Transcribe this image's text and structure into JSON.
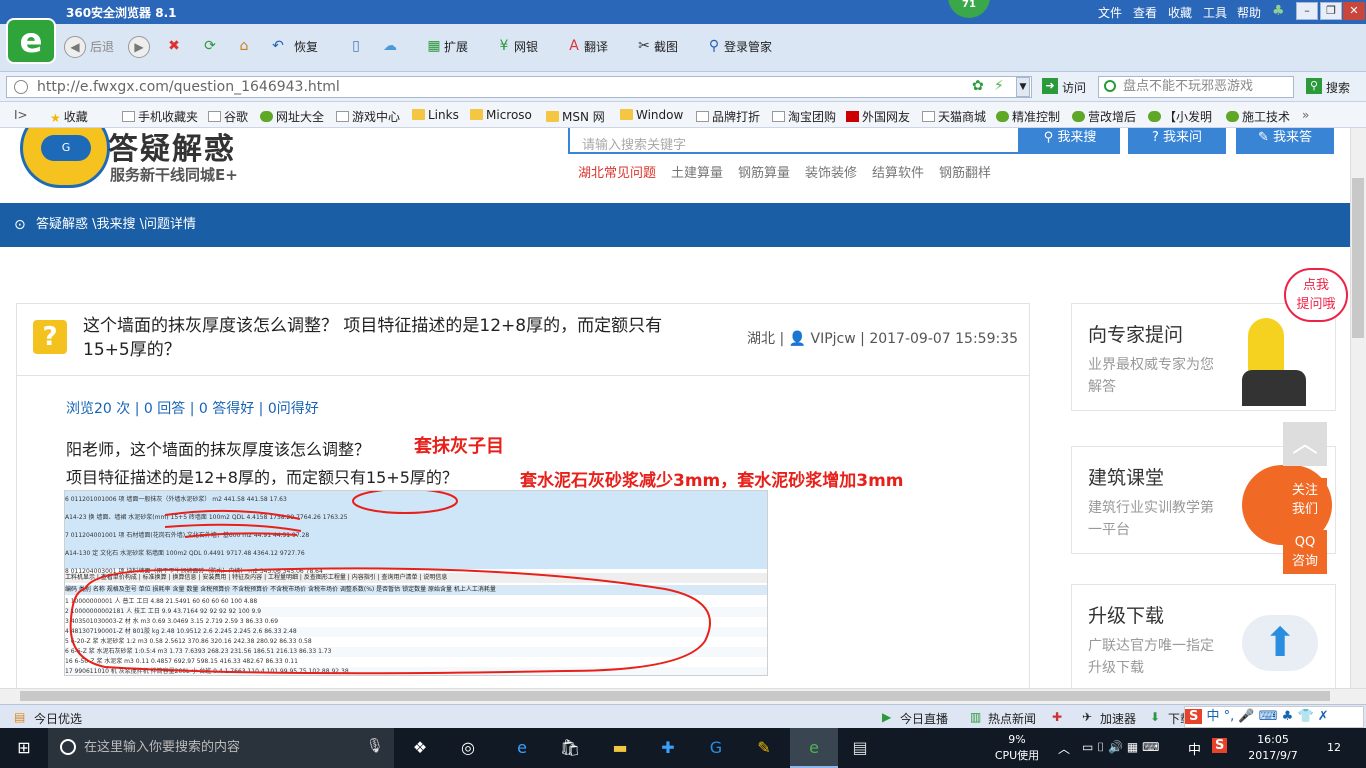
{
  "browser": {
    "title": "360安全浏览器 8.1",
    "badge": "71",
    "menu": [
      "文件",
      "查看",
      "收藏",
      "工具",
      "帮助"
    ],
    "toolbar": {
      "back": "后退",
      "restore": "恢复",
      "extend": "扩展",
      "bank": "网银",
      "translate": "翻译",
      "screenshot": "截图",
      "login": "登录管家"
    },
    "url": "http://e.fwxgx.com/question_1646943.html",
    "visit_label": "访问",
    "search_placeholder": "盘点不能不玩邪恶游戏",
    "search_button": "搜索",
    "favorites": [
      "收藏",
      "手机收藏夹",
      "谷歌",
      "网址大全",
      "游戏中心",
      "Links",
      "Microso",
      "MSN 网",
      "Window",
      "品牌打折",
      "淘宝团购",
      "外国网友",
      "天猫商城",
      "精准控制",
      "营改增后",
      "【小发明",
      "施工技术"
    ]
  },
  "site": {
    "logo_title": "答疑解惑",
    "logo_sub": "服务新干线同城E+",
    "search_placeholder": "请输入搜索关键字",
    "buttons": [
      "我来搜",
      "我来问",
      "我来答"
    ],
    "categories": [
      "湖北常见问题",
      "土建算量",
      "钢筋算量",
      "装饰装修",
      "结算软件",
      "钢筋翻样"
    ],
    "breadcrumb": "答疑解惑 \\我来搜 \\问题详情"
  },
  "question": {
    "title": "这个墙面的抹灰厚度该怎么调整？ 项目特征描述的是12+8厚的，而定额只有15+5厚的？",
    "region": "湖北",
    "user": "VIPjcw",
    "time": "2017-09-07 15:59:35",
    "stats": "浏览20 次 | 0 回答 | 0 答得好 | 0问得好",
    "body_line1": "阳老师，这个墙面的抹灰厚度该怎么调整？",
    "body_line2": "项目特征描述的是12+8厚的，而定额只有15+5厚的？",
    "annotation1": "套抹灰子目",
    "annotation2": "套水泥石灰砂浆减少3mm，套水泥砂浆增加3mm"
  },
  "embedded_table": {
    "rows_top": [
      [
        "6",
        "011201001006",
        "项",
        "墙面一般抹灰（外墙水泥砂浆）",
        "",
        "m2",
        "441.58",
        "441.58",
        "",
        "",
        "17.63"
      ],
      [
        "",
        "A14-23",
        "换",
        "墙面、墙裙 水泥砂浆(mm) 15+5 砖墙面",
        "",
        "100m2",
        "QDL",
        "4.4158",
        "1758.29",
        "7764.26",
        "1763.25"
      ],
      [
        "7",
        "011204001001",
        "项",
        "石材墙面(花岗石外墙)",
        "文化石外墙，基600",
        "m2",
        "44.91",
        "44.91",
        "",
        "",
        "97.28"
      ],
      [
        "",
        "A14-130",
        "定",
        "文化石 水泥砂浆 粘墙面",
        "",
        "100m2",
        "QDL",
        "0.4491",
        "9717.48",
        "4364.12",
        "9727.76"
      ],
      [
        "8",
        "011204003001",
        "项",
        "块料墙面（用于卫生间墙面砖（防水）内墙）",
        "",
        "m2",
        "345.06",
        "345.06",
        "",
        "",
        "78.64"
      ]
    ],
    "tabs": [
      "工料机显示",
      "查看单价构成",
      "标准换算",
      "换算信息",
      "安装费用",
      "特征及内容",
      "工程量明细",
      "反查图形工程量",
      "内容指引",
      "查询用户清单",
      "说明信息"
    ],
    "headers": [
      "编码",
      "类别",
      "名称",
      "规格及型号",
      "单位",
      "损耗率",
      "含量",
      "数量",
      "含税预算价",
      "不含税预算价",
      "不含税市场价",
      "含税市场价",
      "调整系数(%)",
      "是否暂估",
      "锁定数量",
      "原始含量",
      "机上人工消耗量"
    ],
    "rows": [
      [
        "1",
        "10000000001",
        "人",
        "普工",
        "",
        "工日",
        "",
        "4.88",
        "21.5491",
        "60",
        "60",
        "60",
        "60",
        "100",
        "",
        "",
        "4.88"
      ],
      [
        "2",
        "10000000002181",
        "人",
        "技工",
        "",
        "工日",
        "",
        "9.9",
        "43.7164",
        "92",
        "92",
        "92",
        "92",
        "100",
        "",
        "",
        "9.9"
      ],
      [
        "3",
        "403501030003-Z",
        "材",
        "水",
        "",
        "m3",
        "",
        "0.69",
        "3.0469",
        "3.15",
        "2.719",
        "2.59",
        "3",
        "86.33",
        "",
        "",
        "0.69"
      ],
      [
        "4",
        "481307190001-Z",
        "材",
        "801胶",
        "",
        "kg",
        "",
        "2.48",
        "10.9512",
        "2.6",
        "2.245",
        "2.245",
        "2.6",
        "86.33",
        "",
        "",
        "2.48"
      ],
      [
        "5",
        "6-20-Z",
        "浆",
        "水泥砂浆 1:2",
        "",
        "m3",
        "",
        "0.58",
        "2.5612",
        "370.86",
        "320.16",
        "242.38",
        "280.92",
        "86.33",
        "",
        "",
        "0.58"
      ],
      [
        "6",
        "6-6-Z",
        "浆",
        "水泥石灰砂浆 1:0.5:4",
        "",
        "m3",
        "",
        "1.73",
        "7.6393",
        "268.23",
        "231.56",
        "186.51",
        "216.13",
        "86.33",
        "",
        "",
        "1.73"
      ],
      [
        "16",
        "6-50-Z",
        "浆",
        "水泥浆",
        "",
        "m3",
        "",
        "0.11",
        "0.4857",
        "692.97",
        "598.15",
        "416.33",
        "482.67",
        "86.33",
        "",
        "",
        "0.11"
      ],
      [
        "17",
        "990611010",
        "机",
        "灰浆搅拌机",
        "拌筒容量200L 小",
        "台班",
        "",
        "0.4",
        "1.7663",
        "110.4",
        "101.99",
        "95.75",
        "102.88",
        "92.38",
        "",
        "",
        ""
      ]
    ]
  },
  "sidebar": {
    "ask_badge": "点我\n提问哦",
    "cards": [
      {
        "title": "向专家提问",
        "desc": "业界最权威专家为您解答"
      },
      {
        "title": "建筑课堂",
        "desc": "建筑行业实训教学第一平台"
      },
      {
        "title": "升级下载",
        "desc": "广联达官方唯一指定升级下载"
      }
    ],
    "follow": "关注\n我们",
    "qq": "QQ\n咨询"
  },
  "statusbar": {
    "left": "今日优选",
    "items": [
      "今日直播",
      "热点新闻",
      "加速器",
      "下载"
    ]
  },
  "taskbar": {
    "search": "在这里输入你要搜索的内容",
    "cpu": "9%",
    "cpu_label": "CPU使用",
    "ime": "中",
    "time": "16:05",
    "date": "2017/9/7",
    "notif": "12"
  },
  "colors": {
    "brand_blue": "#1a5ea6",
    "accent_orange": "#f06a25",
    "annotation_red": "#e8201a"
  }
}
